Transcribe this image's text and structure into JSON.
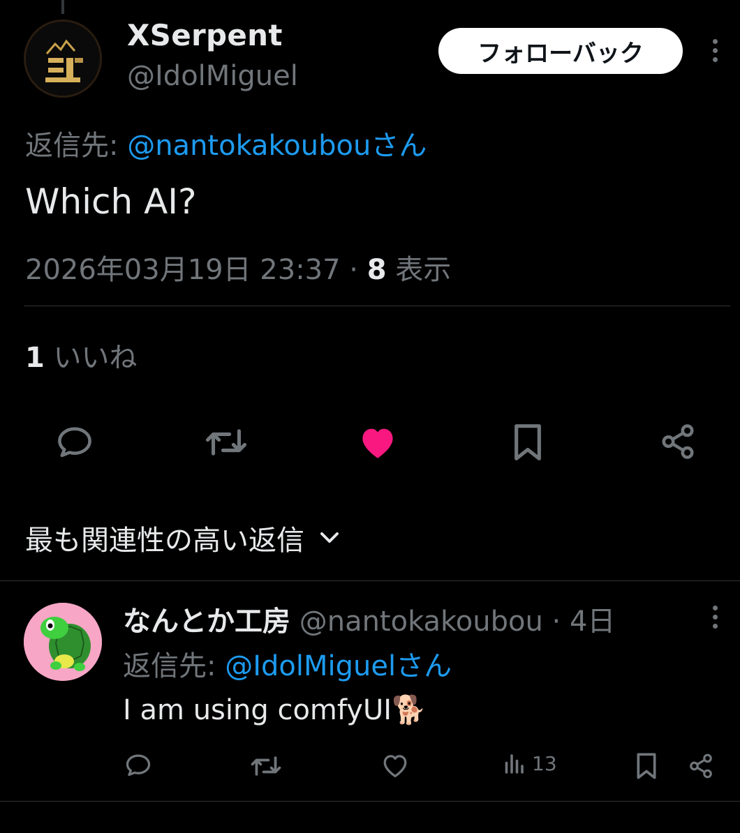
{
  "main_tweet": {
    "display_name": "XSerpent",
    "handle": "@IdolMiguel",
    "follow_label": "フォローバック",
    "reply_to_prefix": "返信先: ",
    "reply_to_mention": "@nantokakoubouさん",
    "text": "Which AI?",
    "timestamp": "2026年03月19日 23:37 · ",
    "views_count": "8",
    "views_label": " 表示",
    "likes_count": "1",
    "likes_label": " いいね",
    "liked": true,
    "icons": [
      "reply-icon",
      "retweet-icon",
      "like-icon",
      "bookmark-icon",
      "share-icon"
    ]
  },
  "sort": {
    "label": "最も関連性の高い返信"
  },
  "reply": {
    "display_name": "なんとか工房",
    "handle": " @nantokakoubou · 4日",
    "reply_to_prefix": "返信先: ",
    "reply_to_mention": "@IdolMiguelさん",
    "text": "I am using comfyUI",
    "emoji": "🐕",
    "views": "13",
    "icons": [
      "reply-icon",
      "retweet-icon",
      "like-icon",
      "views-icon",
      "bookmark-icon",
      "share-icon"
    ]
  },
  "colors": {
    "background": "#000000",
    "text_primary": "#e7e9ea",
    "text_secondary": "#71767b",
    "link": "#1d9bf0",
    "like_active": "#f91880",
    "divider": "#2f3336"
  }
}
